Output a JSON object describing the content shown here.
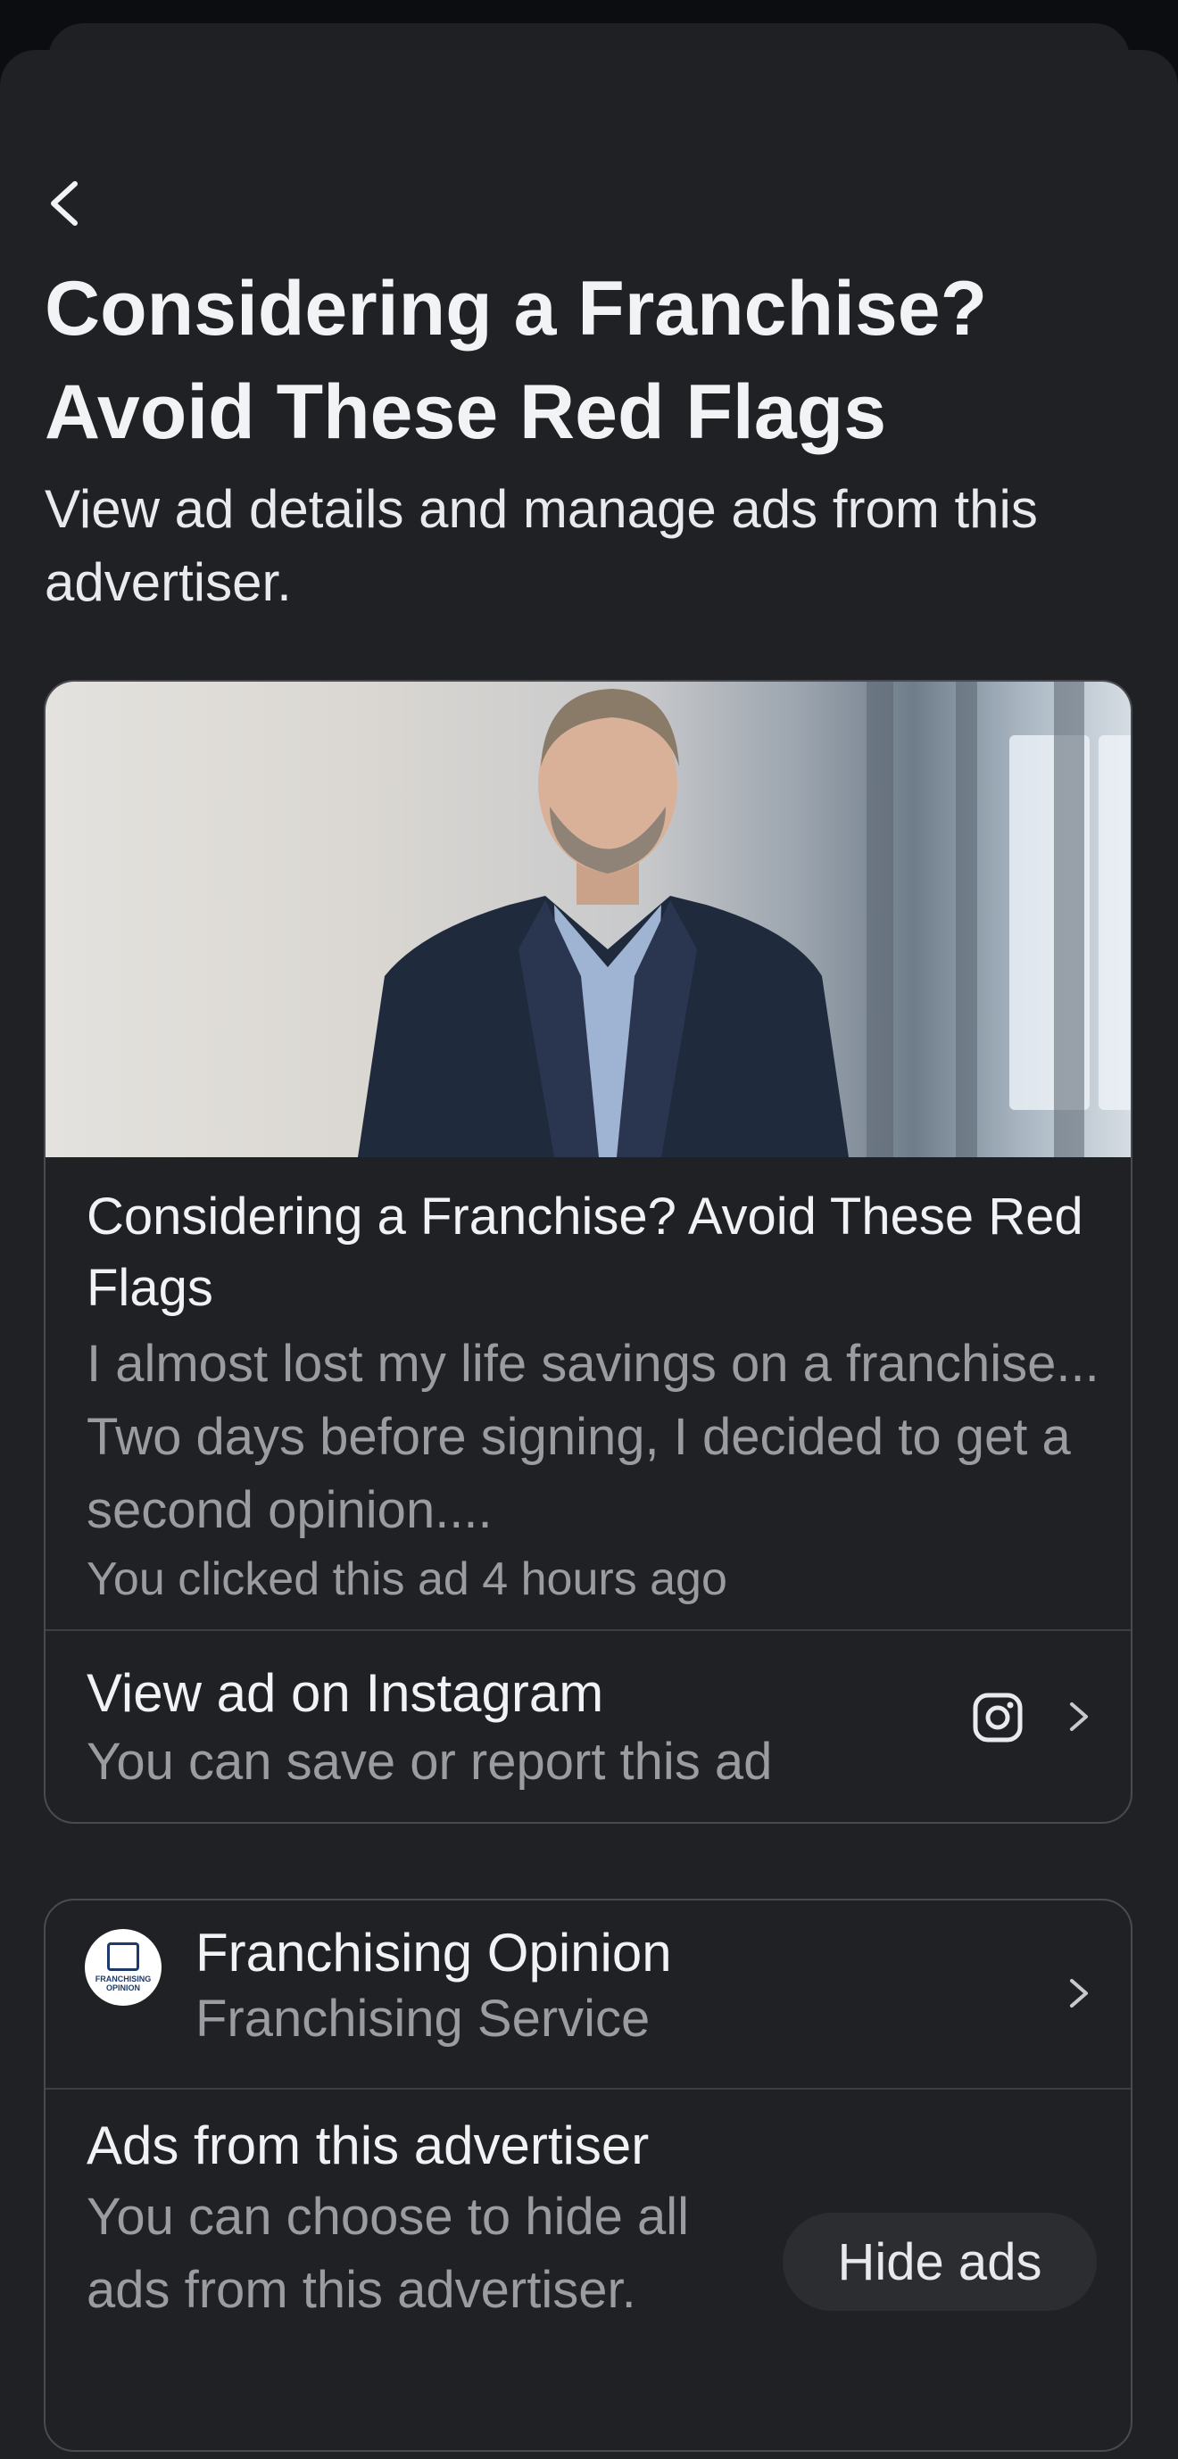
{
  "header": {
    "title": "Considering a Franchise? Avoid These Red Flags",
    "subtitle": "View ad details and manage ads from this advertiser."
  },
  "ad": {
    "headline": "Considering a Franchise? Avoid These Red Flags",
    "body": "I almost lost my life savings on a franchise... Two days before signing, I decided to get a second opinion....",
    "clicked": "You clicked this ad 4 hours ago",
    "instagram_title": "View ad on Instagram",
    "instagram_sub": "You can save or report this ad",
    "image_icon": "instagram-icon"
  },
  "advertiser": {
    "name": "Franchising Opinion",
    "category": "Franchising Service",
    "logo_text": "FRANCHISING OPINION",
    "ads_title": "Ads from this advertiser",
    "ads_sub": "You can choose to hide all ads from this advertiser.",
    "hide_label": "Hide ads"
  }
}
